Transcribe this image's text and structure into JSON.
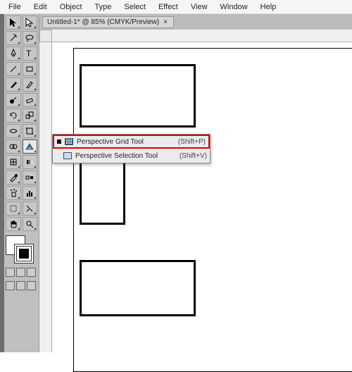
{
  "menu": {
    "file": "File",
    "edit": "Edit",
    "object": "Object",
    "type": "Type",
    "select": "Select",
    "effect": "Effect",
    "view": "View",
    "window": "Window",
    "help": "Help"
  },
  "tab": {
    "title": "Untitled-1* @ 85% (CMYK/Preview)",
    "close": "×"
  },
  "flyout": {
    "items": [
      {
        "label": "Perspective Grid Tool",
        "shortcut": "(Shift+P)"
      },
      {
        "label": "Perspective Selection Tool",
        "shortcut": "(Shift+V)"
      }
    ]
  },
  "tools": {
    "row0": [
      "selection",
      "direct-selection"
    ],
    "row1": [
      "magic-wand",
      "lasso"
    ],
    "row2": [
      "pen",
      "type"
    ],
    "row3": [
      "line",
      "rectangle"
    ],
    "row4": [
      "paintbrush",
      "pencil"
    ],
    "row5": [
      "blob-brush",
      "eraser"
    ],
    "row6": [
      "rotate",
      "scale"
    ],
    "row7": [
      "width",
      "free-transform"
    ],
    "row8": [
      "shape-builder",
      "perspective-grid"
    ],
    "row9": [
      "mesh",
      "gradient"
    ],
    "row10": [
      "eyedropper",
      "blend"
    ],
    "row11": [
      "symbol-sprayer",
      "column-graph"
    ],
    "row12": [
      "artboard",
      "slice"
    ],
    "row13": [
      "hand",
      "zoom"
    ]
  }
}
